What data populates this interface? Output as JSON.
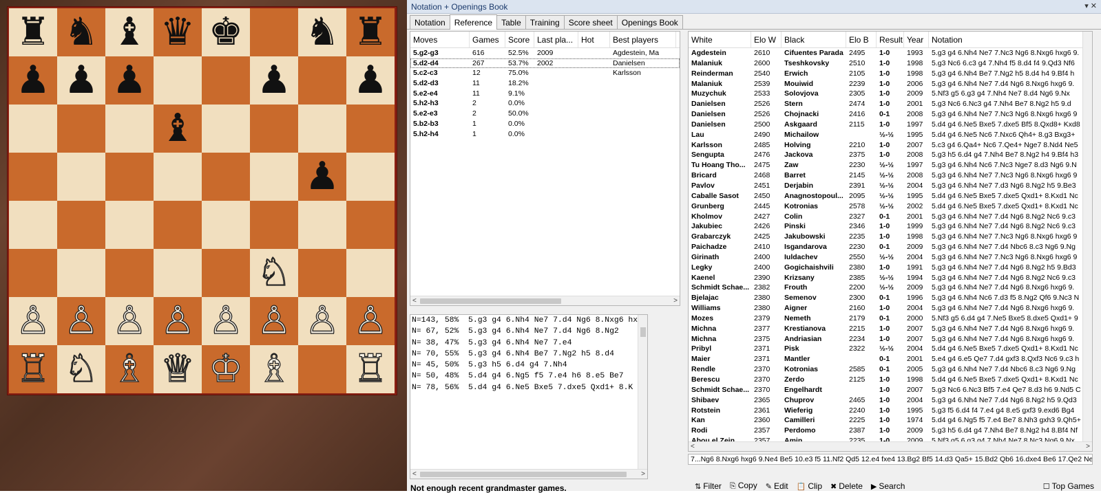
{
  "window": {
    "title": "Notation + Openings Book",
    "control": "▾ ✕"
  },
  "tabs": [
    "Notation",
    "Reference",
    "Table",
    "Training",
    "Score sheet",
    "Openings Book"
  ],
  "active_tab": 1,
  "board": {
    "ranks": [
      [
        "♜",
        "♞",
        "♝",
        "♛",
        "♚",
        "",
        "♞",
        "♜"
      ],
      [
        "♟",
        "♟",
        "♟",
        "",
        "",
        "♟",
        "",
        "♟"
      ],
      [
        "",
        "",
        "",
        "♝",
        "",
        "",
        "",
        ""
      ],
      [
        "",
        "",
        "",
        "",
        "",
        "",
        "♟",
        ""
      ],
      [
        "",
        "",
        "",
        "",
        "",
        "",
        "",
        ""
      ],
      [
        "",
        "",
        "",
        "",
        "",
        "♘",
        "",
        ""
      ],
      [
        "♙",
        "♙",
        "♙",
        "♙",
        "♙",
        "♙",
        "♙",
        "♙"
      ],
      [
        "♖",
        "♘",
        "♗",
        "♕",
        "♔",
        "♗",
        "",
        "♖"
      ]
    ]
  },
  "reference": {
    "headers": [
      "Moves",
      "Games",
      "Score",
      "Last pla...",
      "Hot",
      "Best players"
    ],
    "rows": [
      {
        "move": "5.g2-g3",
        "games": "616",
        "score": "52.5%",
        "last": "2009",
        "hot": "",
        "best": "Agdestein, Ma"
      },
      {
        "move": "5.d2-d4",
        "games": "267",
        "score": "53.7%",
        "last": "2002",
        "hot": "",
        "best": "Danielsen"
      },
      {
        "move": "5.c2-c3",
        "games": "12",
        "score": "75.0%",
        "last": "",
        "hot": "",
        "best": "Karlsson"
      },
      {
        "move": "5.d2-d3",
        "games": "11",
        "score": "18.2%",
        "last": "",
        "hot": "",
        "best": ""
      },
      {
        "move": "5.e2-e4",
        "games": "11",
        "score": "9.1%",
        "last": "",
        "hot": "",
        "best": ""
      },
      {
        "move": "5.h2-h3",
        "games": "2",
        "score": "0.0%",
        "last": "",
        "hot": "",
        "best": ""
      },
      {
        "move": "5.e2-e3",
        "games": "2",
        "score": "50.0%",
        "last": "",
        "hot": "",
        "best": ""
      },
      {
        "move": "5.b2-b3",
        "games": "1",
        "score": "0.0%",
        "last": "",
        "hot": "",
        "best": ""
      },
      {
        "move": "5.h2-h4",
        "games": "1",
        "score": "0.0%",
        "last": "",
        "hot": "",
        "best": ""
      }
    ],
    "selected_row": 1,
    "scroll_left": "<",
    "scroll_right": ">"
  },
  "book_lines": [
    "N=143, 58%  5.g3 g4 6.Nh4 Ne7 7.d4 Ng6 8.Nxg6 hx",
    "N= 67, 52%  5.g3 g4 6.Nh4 Ne7 7.d4 Ng6 8.Ng2",
    "N= 38, 47%  5.g3 g4 6.Nh4 Ne7 7.e4",
    "N= 70, 55%  5.g3 g4 6.Nh4 Be7 7.Ng2 h5 8.d4",
    "N= 45, 50%  5.g3 h5 6.d4 g4 7.Nh4",
    "N= 50, 48%  5.d4 g4 6.Ng5 f5 7.e4 h6 8.e5 Be7",
    "N= 78, 56%  5.d4 g4 6.Ne5 Bxe5 7.dxe5 Qxd1+ 8.K"
  ],
  "book_buttons": {
    "zoom_in": "⊕",
    "zoom_out": "⊖",
    "more": "..."
  },
  "status_text": "Not enough recent grandmaster games.",
  "games": {
    "headers": [
      "White",
      "Elo W",
      "Black",
      "Elo B",
      "Result",
      "Year",
      "Notation"
    ],
    "rows": [
      {
        "white": "Agdestein",
        "elow": "2610",
        "black": "Cifuentes Parada",
        "elob": "2495",
        "result": "1-0",
        "year": "1993",
        "notation": "5.g3 g4 6.Nh4 Ne7 7.Nc3 Ng6 8.Nxg6 hxg6 9."
      },
      {
        "white": "Malaniuk",
        "elow": "2600",
        "black": "Tseshkovsky",
        "elob": "2510",
        "result": "1-0",
        "year": "1998",
        "notation": "5.g3 Nc6 6.c3 g4 7.Nh4 f5 8.d4 f4 9.Qd3 Nf6"
      },
      {
        "white": "Reinderman",
        "elow": "2540",
        "black": "Erwich",
        "elob": "2105",
        "result": "1-0",
        "year": "1998",
        "notation": "5.g3 g4 6.Nh4 Be7 7.Ng2 h5 8.d4 h4 9.Bf4 h"
      },
      {
        "white": "Malaniuk",
        "elow": "2539",
        "black": "Mouiwid",
        "elob": "2239",
        "result": "1-0",
        "year": "2006",
        "notation": "5.g3 g4 6.Nh4 Ne7 7.d4 Ng6 8.Nxg6 hxg6 9."
      },
      {
        "white": "Muzychuk",
        "elow": "2533",
        "black": "Solovjova",
        "elob": "2305",
        "result": "1-0",
        "year": "2009",
        "notation": "5.Nf3 g5 6.g3 g4 7.Nh4 Ne7 8.d4 Ng6 9.Nx"
      },
      {
        "white": "Danielsen",
        "elow": "2526",
        "black": "Stern",
        "elob": "2474",
        "result": "1-0",
        "year": "2001",
        "notation": "5.g3 Nc6 6.Nc3 g4 7.Nh4 Be7 8.Ng2 h5 9.d"
      },
      {
        "white": "Danielsen",
        "elow": "2526",
        "black": "Chojnacki",
        "elob": "2416",
        "result": "0-1",
        "year": "2008",
        "notation": "5.g3 g4 6.Nh4 Ne7 7.Nc3 Ng6 8.Nxg6 hxg6 9"
      },
      {
        "white": "Danielsen",
        "elow": "2500",
        "black": "Askgaard",
        "elob": "2115",
        "result": "1-0",
        "year": "1997",
        "notation": "5.d4 g4 6.Ne5 Bxe5 7.dxe5 Bf5 8.Qxd8+ Kxd8"
      },
      {
        "white": "Lau",
        "elow": "2490",
        "black": "Michailow",
        "elob": "",
        "result": "½-½",
        "year": "1995",
        "notation": "5.d4 g4 6.Ne5 Nc6 7.Nxc6 Qh4+ 8.g3 Bxg3+"
      },
      {
        "white": "Karlsson",
        "elow": "2485",
        "black": "Holving",
        "elob": "2210",
        "result": "1-0",
        "year": "2007",
        "notation": "5.c3 g4 6.Qa4+ Nc6 7.Qe4+ Nge7 8.Nd4 Ne5"
      },
      {
        "white": "Sengupta",
        "elow": "2476",
        "black": "Jackova",
        "elob": "2375",
        "result": "1-0",
        "year": "2008",
        "notation": "5.g3 h5 6.d4 g4 7.Nh4 Be7 8.Ng2 h4 9.Bf4 h3"
      },
      {
        "white": "Tu Hoang Tho...",
        "elow": "2475",
        "black": "Zaw",
        "elob": "2230",
        "result": "½-½",
        "year": "1997",
        "notation": "5.g3 g4 6.Nh4 Nc6 7.Nc3 Nge7 8.d3 Ng6 9.N"
      },
      {
        "white": "Bricard",
        "elow": "2468",
        "black": "Barret",
        "elob": "2145",
        "result": "½-½",
        "year": "2008",
        "notation": "5.g3 g4 6.Nh4 Ne7 7.Nc3 Ng6 8.Nxg6 hxg6 9"
      },
      {
        "white": "Pavlov",
        "elow": "2451",
        "black": "Derjabin",
        "elob": "2391",
        "result": "½-½",
        "year": "2004",
        "notation": "5.g3 g4 6.Nh4 Ne7 7.d3 Ng6 8.Ng2 h5 9.Be3"
      },
      {
        "white": "Caballe Sasot",
        "elow": "2450",
        "black": "Anagnostopoul...",
        "elob": "2095",
        "result": "½-½",
        "year": "1995",
        "notation": "5.d4 g4 6.Ne5 Bxe5 7.dxe5 Qxd1+ 8.Kxd1 Nc"
      },
      {
        "white": "Grunberg",
        "elow": "2445",
        "black": "Kotronias",
        "elob": "2578",
        "result": "½-½",
        "year": "2002",
        "notation": "5.d4 g4 6.Ne5 Bxe5 7.dxe5 Qxd1+ 8.Kxd1 Nc"
      },
      {
        "white": "Kholmov",
        "elow": "2427",
        "black": "Colin",
        "elob": "2327",
        "result": "0-1",
        "year": "2001",
        "notation": "5.g3 g4 6.Nh4 Ne7 7.d4 Ng6 8.Ng2 Nc6 9.c3"
      },
      {
        "white": "Jakubiec",
        "elow": "2426",
        "black": "Pinski",
        "elob": "2346",
        "result": "1-0",
        "year": "1999",
        "notation": "5.g3 g4 6.Nh4 Ne7 7.d4 Ng6 8.Ng2 Nc6 9.c3"
      },
      {
        "white": "Grabarczyk",
        "elow": "2425",
        "black": "Jakubowski",
        "elob": "2235",
        "result": "1-0",
        "year": "1998",
        "notation": "5.g3 g4 6.Nh4 Ne7 7.Nc3 Ng6 8.Nxg6 hxg6 9"
      },
      {
        "white": "Paichadze",
        "elow": "2410",
        "black": "Isgandarova",
        "elob": "2230",
        "result": "0-1",
        "year": "2009",
        "notation": "5.g3 g4 6.Nh4 Ne7 7.d4 Nbc6 8.c3 Ng6 9.Ng"
      },
      {
        "white": "Girinath",
        "elow": "2400",
        "black": "Iuldachev",
        "elob": "2550",
        "result": "½-½",
        "year": "2004",
        "notation": "5.g3 g4 6.Nh4 Ne7 7.Nc3 Ng6 8.Nxg6 hxg6 9"
      },
      {
        "white": "Legky",
        "elow": "2400",
        "black": "Gogichaishvili",
        "elob": "2380",
        "result": "1-0",
        "year": "1991",
        "notation": "5.g3 g4 6.Nh4 Ne7 7.d4 Ng6 8.Ng2 h5 9.Bd3"
      },
      {
        "white": "Kaenel",
        "elow": "2390",
        "black": "Krizsany",
        "elob": "2385",
        "result": "½-½",
        "year": "1994",
        "notation": "5.g3 g4 6.Nh4 Ne7 7.d4 Ng6 8.Ng2 Nc6 9.c3"
      },
      {
        "white": "Schmidt Schae...",
        "elow": "2382",
        "black": "Frouth",
        "elob": "2200",
        "result": "½-½",
        "year": "2009",
        "notation": "5.g3 g4 6.Nh4 Ne7 7.d4 Ng6 8.Nxg6 hxg6 9."
      },
      {
        "white": "Bjelajac",
        "elow": "2380",
        "black": "Semenov",
        "elob": "2300",
        "result": "0-1",
        "year": "1996",
        "notation": "5.g3 g4 6.Nh4 Nc6 7.d3 f5 8.Ng2 Qf6 9.Nc3 N"
      },
      {
        "white": "Williams",
        "elow": "2380",
        "black": "Aigner",
        "elob": "2160",
        "result": "1-0",
        "year": "2004",
        "notation": "5.g3 g4 6.Nh4 Ne7 7.d4 Ng6 8.Nxg6 hxg6 9."
      },
      {
        "white": "Mozes",
        "elow": "2379",
        "black": "Nemeth",
        "elob": "2179",
        "result": "0-1",
        "year": "2000",
        "notation": "5.Nf3 g5 6.d4 g4 7.Ne5 Bxe5 8.dxe5 Qxd1+ 9"
      },
      {
        "white": "Michna",
        "elow": "2377",
        "black": "Krestianova",
        "elob": "2215",
        "result": "1-0",
        "year": "2007",
        "notation": "5.g3 g4 6.Nh4 Ne7 7.d4 Ng6 8.Nxg6 hxg6 9."
      },
      {
        "white": "Michna",
        "elow": "2375",
        "black": "Andriasian",
        "elob": "2234",
        "result": "1-0",
        "year": "2007",
        "notation": "5.g3 g4 6.Nh4 Ne7 7.d4 Ng6 8.Nxg6 hxg6 9."
      },
      {
        "white": "Pribyl",
        "elow": "2371",
        "black": "Pisk",
        "elob": "2322",
        "result": "½-½",
        "year": "2004",
        "notation": "5.d4 g4 6.Ne5 Bxe5 7.dxe5 Qxd1+ 8.Kxd1 Nc"
      },
      {
        "white": "Maier",
        "elow": "2371",
        "black": "Mantler",
        "elob": "",
        "result": "0-1",
        "year": "2001",
        "notation": "5.e4 g4 6.e5 Qe7 7.d4 gxf3 8.Qxf3 Nc6 9.c3 h"
      },
      {
        "white": "Rendle",
        "elow": "2370",
        "black": "Kotronias",
        "elob": "2585",
        "result": "0-1",
        "year": "2005",
        "notation": "5.g3 g4 6.Nh4 Ne7 7.d4 Nbc6 8.c3 Ng6 9.Ng"
      },
      {
        "white": "Berescu",
        "elow": "2370",
        "black": "Zerdo",
        "elob": "2125",
        "result": "1-0",
        "year": "1998",
        "notation": "5.d4 g4 6.Ne5 Bxe5 7.dxe5 Qxd1+ 8.Kxd1 Nc"
      },
      {
        "white": "Schmidt Schae...",
        "elow": "2370",
        "black": "Engelhardt",
        "elob": "",
        "result": "1-0",
        "year": "2007",
        "notation": "5.g3 Nc6 6.Nc3 Bf5 7.e4 Qe7 8.d3 h6 9.Nd5 C"
      },
      {
        "white": "Shibaev",
        "elow": "2365",
        "black": "Chuprov",
        "elob": "2465",
        "result": "1-0",
        "year": "2004",
        "notation": "5.g3 g4 6.Nh4 Ne7 7.d4 Ng6 8.Ng2 h5 9.Qd3"
      },
      {
        "white": "Rotstein",
        "elow": "2361",
        "black": "Wieferig",
        "elob": "2240",
        "result": "1-0",
        "year": "1995",
        "notation": "5.g3 f5 6.d4 f4 7.e4 g4 8.e5 gxf3 9.exd6 Bg4"
      },
      {
        "white": "Kan",
        "elow": "2360",
        "black": "Camilleri",
        "elob": "2225",
        "result": "1-0",
        "year": "1974",
        "notation": "5.d4 g4 6.Ng5 f5 7.e4 Be7 8.Nh3 gxh3 9.Qh5+"
      },
      {
        "white": "Rodi",
        "elow": "2357",
        "black": "Perdomo",
        "elob": "2387",
        "result": "1-0",
        "year": "2009",
        "notation": "5.g3 h5 6.d4 g4 7.Nh4 Be7 8.Ng2 h4 8.Bf4 Nf"
      },
      {
        "white": "Abou el Zein",
        "elow": "2357",
        "black": "Amin",
        "elob": "2235",
        "result": "1-0",
        "year": "2009",
        "notation": "5.Nf3 g5 6.g3 g4 7.Nh4 Ne7 8.Nc3 Ng6 9.Nx"
      }
    ]
  },
  "notation_line": "7...Ng6 8.Nxg6 hxg6 9.Ne4 Be5 10.e3 f5 11.Nf2 Qd5 12.e4 fxe4 13.Bg2 Bf5 14.d3 Qa5+ 15.Bd2 Qb6 16.dxe4 Be6 17.Qe2 Ne",
  "toolbar": [
    {
      "icon": "⇅",
      "label": "Filter"
    },
    {
      "icon": "⎘",
      "label": "Copy"
    },
    {
      "icon": "✎",
      "label": "Edit"
    },
    {
      "icon": "📋",
      "label": "Clip"
    },
    {
      "icon": "✖",
      "label": "Delete"
    },
    {
      "icon": "▶",
      "label": "Search"
    },
    {
      "icon": "☐",
      "label": "Top Games"
    }
  ]
}
